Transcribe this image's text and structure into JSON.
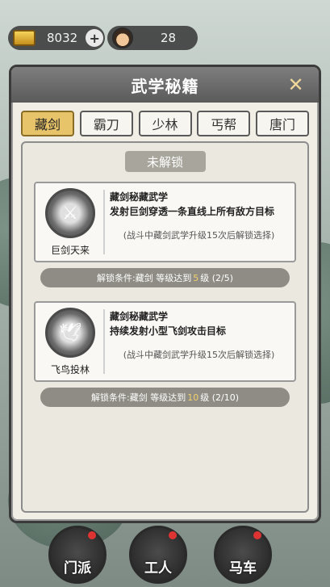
{
  "resources": {
    "gold": "8032",
    "plus": "+",
    "people": "28"
  },
  "panel": {
    "title": "武学秘籍",
    "close": "✕"
  },
  "tabs": [
    {
      "label": "藏剑",
      "active": true
    },
    {
      "label": "霸刀"
    },
    {
      "label": "少林"
    },
    {
      "label": "丐帮"
    },
    {
      "label": "唐门"
    }
  ],
  "locked_label": "未解锁",
  "skills": [
    {
      "name": "巨剑天来",
      "title": "藏剑秘藏武学",
      "desc": "发射巨剑穿透一条直线上所有敌方目标",
      "note": "(战斗中藏剑武学升级15次后解锁选择)",
      "unlock_prefix": "解锁条件:藏剑 等级达到",
      "unlock_level": "5",
      "unlock_suffix": "级 (2/5)"
    },
    {
      "name": "飞鸟投林",
      "title": "藏剑秘藏武学",
      "desc": "持续发射小型飞剑攻击目标",
      "note": "(战斗中藏剑武学升级15次后解锁选择)",
      "unlock_prefix": "解锁条件:藏剑 等级达到",
      "unlock_level": "10",
      "unlock_suffix": "级 (2/10)"
    }
  ],
  "bottom_nav": [
    {
      "label": "门派"
    },
    {
      "label": "工人"
    },
    {
      "label": "马车"
    }
  ]
}
